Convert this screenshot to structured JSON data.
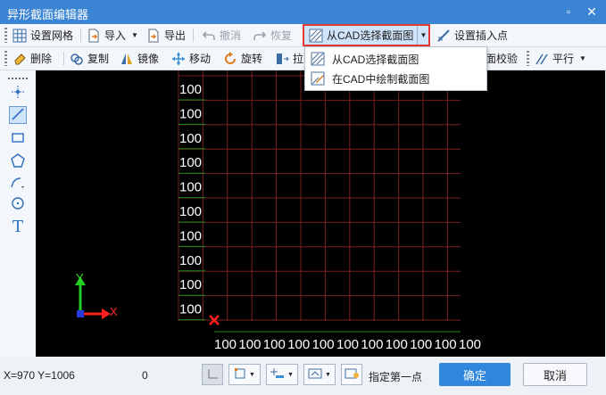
{
  "window": {
    "title": "异形截面编辑器"
  },
  "toolbar1": {
    "set_grid": "设置网格",
    "import": "导入",
    "export": "导出",
    "undo": "撤消",
    "redo": "恢复",
    "select_from_cad": "从CAD选择截面图",
    "set_insert_point": "设置插入点"
  },
  "toolbar2": {
    "delete": "删除",
    "copy": "复制",
    "mirror": "镜像",
    "move": "移动",
    "rotate": "旋转",
    "stretch": "拉",
    "check": "面校验",
    "parallel": "平行"
  },
  "dropdown": {
    "items": [
      "从CAD选择截面图",
      "在CAD中绘制截面图"
    ]
  },
  "grid": {
    "row_labels": [
      "100",
      "100",
      "100",
      "100",
      "100",
      "100",
      "100",
      "100",
      "100",
      "100"
    ],
    "col_labels": [
      "100",
      "100",
      "100",
      "100",
      "100",
      "100",
      "100",
      "100",
      "100",
      "100",
      "100"
    ]
  },
  "axis": {
    "x": "X",
    "y": "Y"
  },
  "status": {
    "coords": "X=970 Y=1006",
    "value": "0",
    "prompt": "指定第一点"
  },
  "buttons": {
    "ok": "确定",
    "cancel": "取消"
  },
  "colors": {
    "accent": "#3a84d3",
    "primary_button": "#2f86dd",
    "highlight_border": "#e53935",
    "grid_line": "#7a1f1f",
    "axis_label": "#ffffff",
    "origin_marker": "#ff2020"
  }
}
